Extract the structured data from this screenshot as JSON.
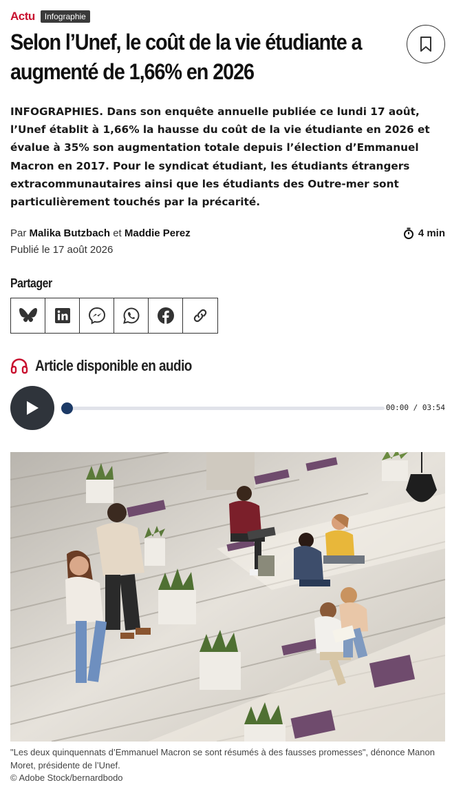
{
  "header": {
    "rubric": "Actu",
    "tag": "Infographie",
    "bookmark_icon": "bookmark-icon"
  },
  "article": {
    "title": "Selon l’Unef, le coût de la vie étudiante a augmenté de 1,66% en 2026",
    "lede": "INFOGRAPHIES. Dans son enquête annuelle publiée ce lundi 17 août, l’Unef établit à 1,66% la hausse du coût de la vie étudiante en 2026 et évalue à 35% son augmentation totale depuis l’élection d’Emmanuel Macron en 2017. Pour le syndicat étudiant, les étudiants étrangers extracommunautaires ainsi que les étudiants des Outre-mer sont particulièrement touchés par la précarité.",
    "byline_prefix": "Par",
    "author_1": "Malika Butzbach",
    "byline_and": "et",
    "author_2": "Maddie Perez",
    "read_time": "4 min",
    "published": "Publié le 17 août 2026"
  },
  "share": {
    "title": "Partager",
    "buttons": [
      {
        "icon": "bluesky-icon"
      },
      {
        "icon": "linkedin-icon"
      },
      {
        "icon": "messenger-icon"
      },
      {
        "icon": "whatsapp-icon"
      },
      {
        "icon": "facebook-icon"
      },
      {
        "icon": "link-icon"
      }
    ]
  },
  "audio": {
    "title": "Article disponible en audio",
    "time": "00:00 / 03:54",
    "progress_fraction": 0.0
  },
  "photo": {
    "caption": "\"Les deux quinquennats d’Emmanuel Macron se sont résumés à des fausses promesses\", dénonce Manon Moret, présidente de l’Unef.",
    "credit": "© Adobe Stock/bernardbodo"
  },
  "colors": {
    "accent": "#c8102e",
    "player": "#2f343b",
    "progress": "#1c3a66"
  }
}
